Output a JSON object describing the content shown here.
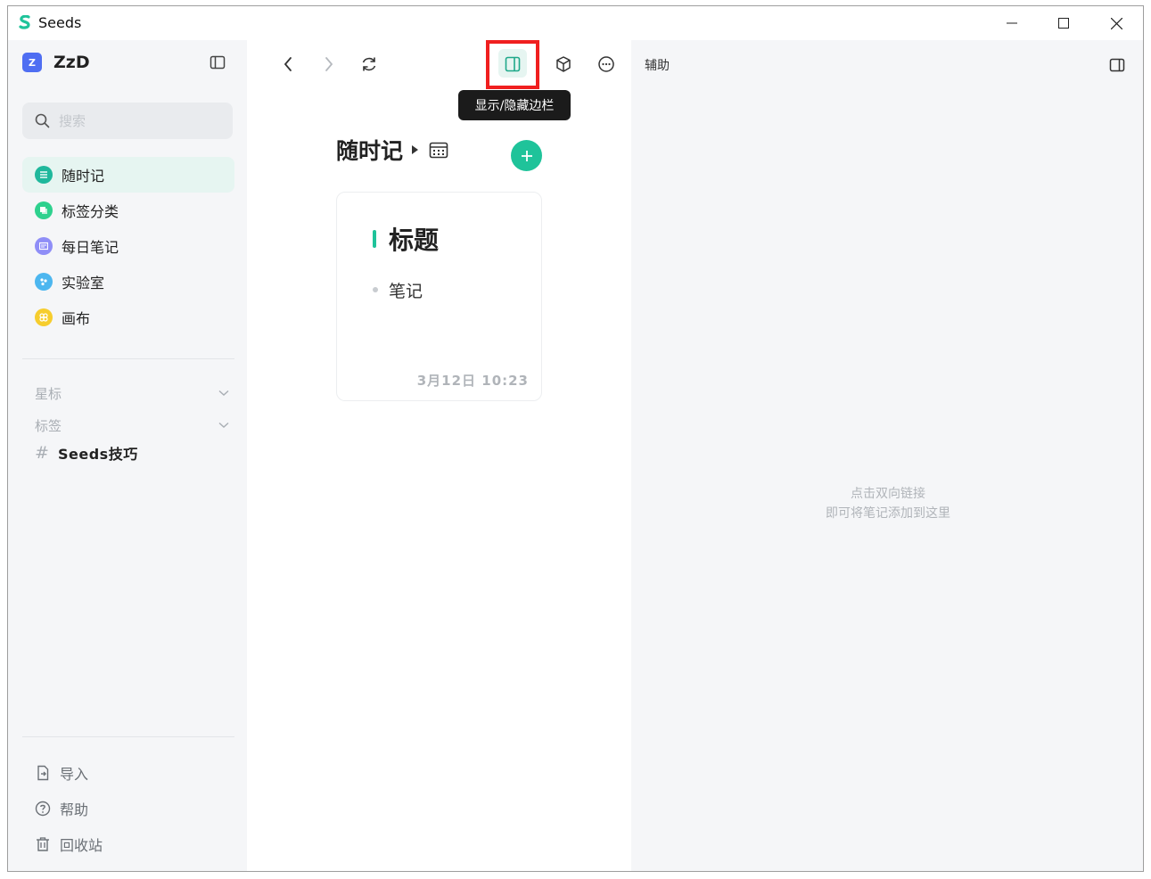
{
  "window": {
    "title": "Seeds"
  },
  "workspace": {
    "avatar": "Z",
    "name": "ZzD"
  },
  "search": {
    "placeholder": "搜索"
  },
  "sidebar": {
    "items": [
      {
        "label": "随时记",
        "icon": "notes-icon",
        "color": "#1fb89c",
        "active": true
      },
      {
        "label": "标签分类",
        "icon": "tag-category-icon",
        "color": "#2ed18e",
        "active": false
      },
      {
        "label": "每日笔记",
        "icon": "daily-note-icon",
        "color": "#8f8ef7",
        "active": false
      },
      {
        "label": "实验室",
        "icon": "lab-icon",
        "color": "#4cb6ef",
        "active": false
      },
      {
        "label": "画布",
        "icon": "canvas-icon",
        "color": "#f6cd2e",
        "active": false
      }
    ],
    "sections": {
      "starred": "星标",
      "tags": "标签"
    },
    "tag_items": [
      {
        "hash": "#",
        "label": "Seeds技巧"
      }
    ],
    "bottom": [
      {
        "label": "导入",
        "icon": "import-icon"
      },
      {
        "label": "帮助",
        "icon": "help-icon"
      },
      {
        "label": "回收站",
        "icon": "trash-icon"
      }
    ]
  },
  "toolbar": {
    "tooltip": "显示/隐藏边栏"
  },
  "list": {
    "title": "随时记",
    "cards": [
      {
        "title": "标题",
        "body": "笔记",
        "date": "3月12日 10:23"
      }
    ]
  },
  "right_panel": {
    "title": "辅助",
    "empty_line1": "点击双向链接",
    "empty_line2": "即可将笔记添加到这里"
  },
  "colors": {
    "accent": "#1fc39a",
    "highlight": "#f01f1f",
    "workspace_avatar": "#4f6ef2"
  }
}
